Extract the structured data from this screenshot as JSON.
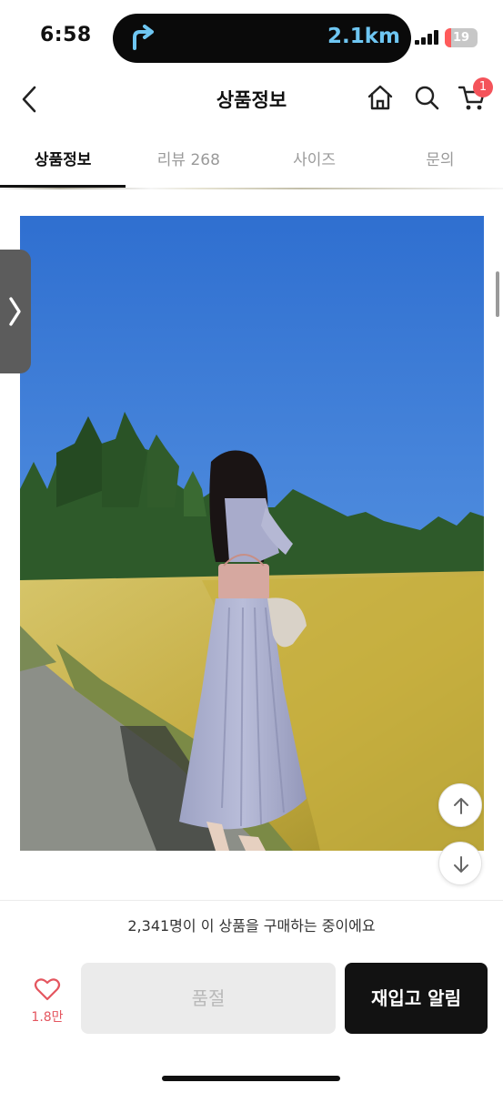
{
  "status_bar": {
    "time": "6:58",
    "navigation_distance": "2.1km",
    "battery_level": "19"
  },
  "header": {
    "title": "상품정보",
    "cart_count": "1"
  },
  "tabs": [
    {
      "label": "상품정보",
      "active": true
    },
    {
      "label": "리뷰 268",
      "active": false
    },
    {
      "label": "사이즈",
      "active": false
    },
    {
      "label": "문의",
      "active": false
    }
  ],
  "footer": {
    "buyers_text": "2,341명이 이 상품을 구매하는 중이에요",
    "like_count": "1.8만",
    "soldout_label": "품절",
    "restock_label": "재입고 알림"
  },
  "colors": {
    "accent_red": "#f4535a",
    "sky": "#3f7fd6",
    "field": "#c9b54a",
    "dark_button": "#121212"
  },
  "icons": [
    "navigation-arrow-icon",
    "back-icon",
    "home-icon",
    "search-icon",
    "cart-icon",
    "chevron-right-icon",
    "arrow-up-icon",
    "arrow-down-icon",
    "heart-icon"
  ]
}
